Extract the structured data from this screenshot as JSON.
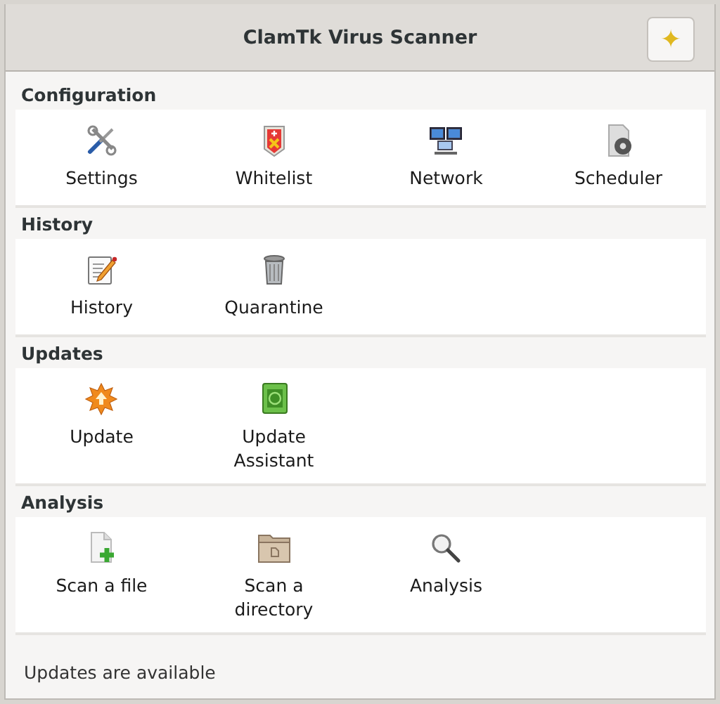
{
  "window": {
    "title": "ClamTk Virus Scanner",
    "header_button": {
      "icon": "✦"
    }
  },
  "sections": [
    {
      "title": "Configuration",
      "items": [
        {
          "label": "Settings",
          "kind": "tools"
        },
        {
          "label": "Whitelist",
          "kind": "shield"
        },
        {
          "label": "Network",
          "kind": "network"
        },
        {
          "label": "Scheduler",
          "kind": "gear-doc"
        }
      ]
    },
    {
      "title": "History",
      "items": [
        {
          "label": "History",
          "kind": "notepad"
        },
        {
          "label": "Quarantine",
          "kind": "trash"
        }
      ]
    },
    {
      "title": "Updates",
      "items": [
        {
          "label": "Update",
          "kind": "burst"
        },
        {
          "label": "Update Assistant",
          "kind": "green-book"
        }
      ]
    },
    {
      "title": "Analysis",
      "items": [
        {
          "label": "Scan a file",
          "kind": "file-add"
        },
        {
          "label": "Scan a directory",
          "kind": "folder"
        },
        {
          "label": "Analysis",
          "kind": "magnifier"
        }
      ]
    }
  ],
  "status_bar": {
    "text": "Updates are available"
  }
}
